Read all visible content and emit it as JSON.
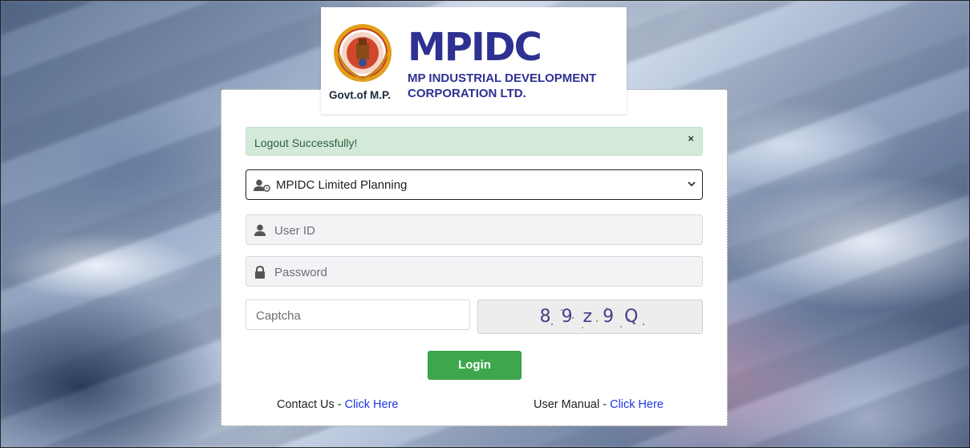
{
  "logo": {
    "govt_text": "Govt.of M.P.",
    "brand_part1": "M",
    "brand_part2": "PIDC",
    "corp_line1": "MP INDUSTRIAL DEVELOPMENT",
    "corp_line2": "CORPORATION LTD."
  },
  "alert": {
    "message": "Logout Successfully!",
    "close": "×"
  },
  "role_select": {
    "value": "MPIDC Limited Planning",
    "icon": "user-cog-icon"
  },
  "user_id": {
    "placeholder": "User ID",
    "icon": "user-icon"
  },
  "password": {
    "placeholder": "Password",
    "icon": "lock-icon"
  },
  "captcha": {
    "placeholder": "Captcha",
    "code": "8 9 z 9 Q"
  },
  "login": {
    "label": "Login"
  },
  "footer": {
    "contact_prefix": "Contact Us - ",
    "contact_link": "Click Here",
    "manual_prefix": "User Manual - ",
    "manual_link": "Click Here"
  },
  "colors": {
    "brand_blue": "#2e3192",
    "alert_bg": "#d3ead9",
    "login_green": "#3ea74b",
    "link_blue": "#1f36e0"
  }
}
